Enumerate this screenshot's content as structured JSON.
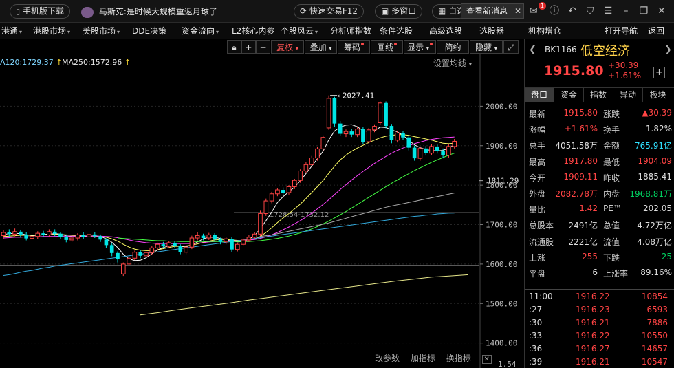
{
  "topbar": {
    "mobile_download": "手机版下载",
    "news_source": "马斯克:",
    "news_text": "是时候大规模重返月球了",
    "quick_trade": "快速交易F12",
    "multi_window": "多窗口",
    "self_select": "自选",
    "view_news": "查看新消息",
    "badge_count": "1"
  },
  "menubar": {
    "items": [
      "港通",
      "港股市场",
      "美股市场",
      "DDE决策",
      "资金流向",
      "L2核心内参",
      "个股风云",
      "分析师指数",
      "条件选股",
      "高级选股",
      "选股器",
      "机构增仓",
      "打开导航",
      "返回"
    ]
  },
  "chart_toolbar": {
    "fuquan": "复权",
    "overlay": "叠加",
    "chips": "筹码",
    "draw": "画线",
    "display": "显示",
    "simple": "简约",
    "hide": "隐藏"
  },
  "ma_labels": {
    "ma120": "A120:1729.37",
    "ma250": "MA250:1572.96"
  },
  "setting_ma": "设置均线",
  "annotations": {
    "high": "2027.41",
    "range": "1728.54-1732.12"
  },
  "bottom_links": [
    "改参数",
    "加指标",
    "换指标"
  ],
  "chart_data": {
    "type": "candlestick",
    "y_ticks": [
      2000,
      1900,
      1800,
      1700,
      1600,
      1500,
      1400
    ],
    "y_tick_labels": [
      "2000.00",
      "1900.00",
      "1800.00",
      "1700.00",
      "1600.00",
      "1500.00",
      "1400.00"
    ],
    "current_price_label": "1811.29",
    "ylim": [
      1375,
      2100
    ],
    "high_marker": 2027.41,
    "range_marker_level": 1730.3,
    "bottom_tick_label": "1.54",
    "candles": [
      {
        "o": 1672,
        "c": 1680,
        "h": 1686,
        "l": 1664
      },
      {
        "o": 1680,
        "c": 1676,
        "h": 1688,
        "l": 1668
      },
      {
        "o": 1676,
        "c": 1682,
        "h": 1690,
        "l": 1670
      },
      {
        "o": 1682,
        "c": 1675,
        "h": 1687,
        "l": 1667
      },
      {
        "o": 1675,
        "c": 1665,
        "h": 1680,
        "l": 1660
      },
      {
        "o": 1665,
        "c": 1670,
        "h": 1676,
        "l": 1658
      },
      {
        "o": 1670,
        "c": 1678,
        "h": 1683,
        "l": 1664
      },
      {
        "o": 1678,
        "c": 1674,
        "h": 1684,
        "l": 1668
      },
      {
        "o": 1674,
        "c": 1682,
        "h": 1688,
        "l": 1670
      },
      {
        "o": 1682,
        "c": 1677,
        "h": 1688,
        "l": 1671
      },
      {
        "o": 1677,
        "c": 1669,
        "h": 1681,
        "l": 1663
      },
      {
        "o": 1669,
        "c": 1661,
        "h": 1674,
        "l": 1655
      },
      {
        "o": 1661,
        "c": 1666,
        "h": 1671,
        "l": 1656
      },
      {
        "o": 1666,
        "c": 1674,
        "h": 1678,
        "l": 1660
      },
      {
        "o": 1674,
        "c": 1669,
        "h": 1680,
        "l": 1663
      },
      {
        "o": 1669,
        "c": 1675,
        "h": 1681,
        "l": 1664
      },
      {
        "o": 1675,
        "c": 1671,
        "h": 1680,
        "l": 1666
      },
      {
        "o": 1671,
        "c": 1662,
        "h": 1675,
        "l": 1656
      },
      {
        "o": 1662,
        "c": 1648,
        "h": 1665,
        "l": 1640
      },
      {
        "o": 1648,
        "c": 1628,
        "h": 1652,
        "l": 1620
      },
      {
        "o": 1628,
        "c": 1612,
        "h": 1632,
        "l": 1604
      },
      {
        "o": 1575,
        "c": 1600,
        "h": 1604,
        "l": 1570
      },
      {
        "o": 1600,
        "c": 1615,
        "h": 1620,
        "l": 1596
      },
      {
        "o": 1615,
        "c": 1630,
        "h": 1634,
        "l": 1610
      },
      {
        "o": 1630,
        "c": 1621,
        "h": 1635,
        "l": 1615
      },
      {
        "o": 1621,
        "c": 1629,
        "h": 1634,
        "l": 1616
      },
      {
        "o": 1629,
        "c": 1641,
        "h": 1646,
        "l": 1624
      },
      {
        "o": 1641,
        "c": 1650,
        "h": 1654,
        "l": 1636
      },
      {
        "o": 1650,
        "c": 1645,
        "h": 1656,
        "l": 1640
      },
      {
        "o": 1645,
        "c": 1654,
        "h": 1659,
        "l": 1640
      },
      {
        "o": 1654,
        "c": 1646,
        "h": 1658,
        "l": 1640
      },
      {
        "o": 1646,
        "c": 1630,
        "h": 1650,
        "l": 1625
      },
      {
        "o": 1630,
        "c": 1643,
        "h": 1648,
        "l": 1625
      },
      {
        "o": 1643,
        "c": 1666,
        "h": 1672,
        "l": 1638
      },
      {
        "o": 1666,
        "c": 1672,
        "h": 1680,
        "l": 1660
      },
      {
        "o": 1672,
        "c": 1666,
        "h": 1677,
        "l": 1660
      },
      {
        "o": 1666,
        "c": 1674,
        "h": 1679,
        "l": 1661
      },
      {
        "o": 1674,
        "c": 1662,
        "h": 1678,
        "l": 1657
      },
      {
        "o": 1662,
        "c": 1656,
        "h": 1667,
        "l": 1650
      },
      {
        "o": 1656,
        "c": 1664,
        "h": 1668,
        "l": 1650
      },
      {
        "o": 1664,
        "c": 1637,
        "h": 1668,
        "l": 1630
      },
      {
        "o": 1637,
        "c": 1650,
        "h": 1654,
        "l": 1632
      },
      {
        "o": 1650,
        "c": 1661,
        "h": 1665,
        "l": 1645
      },
      {
        "o": 1661,
        "c": 1668,
        "h": 1673,
        "l": 1656
      },
      {
        "o": 1668,
        "c": 1676,
        "h": 1681,
        "l": 1663
      },
      {
        "o": 1676,
        "c": 1728,
        "h": 1735,
        "l": 1671
      },
      {
        "o": 1728,
        "c": 1760,
        "h": 1766,
        "l": 1722
      },
      {
        "o": 1760,
        "c": 1778,
        "h": 1783,
        "l": 1754
      },
      {
        "o": 1778,
        "c": 1788,
        "h": 1793,
        "l": 1772
      },
      {
        "o": 1788,
        "c": 1781,
        "h": 1794,
        "l": 1776
      },
      {
        "o": 1781,
        "c": 1796,
        "h": 1800,
        "l": 1776
      },
      {
        "o": 1796,
        "c": 1812,
        "h": 1816,
        "l": 1790
      },
      {
        "o": 1812,
        "c": 1836,
        "h": 1840,
        "l": 1806
      },
      {
        "o": 1836,
        "c": 1852,
        "h": 1858,
        "l": 1830
      },
      {
        "o": 1852,
        "c": 1869,
        "h": 1874,
        "l": 1846
      },
      {
        "o": 1869,
        "c": 1892,
        "h": 1896,
        "l": 1862
      },
      {
        "o": 1892,
        "c": 1921,
        "h": 1926,
        "l": 1886
      },
      {
        "o": 1945,
        "c": 2020,
        "h": 2027.41,
        "l": 1940
      },
      {
        "o": 2020,
        "c": 1956,
        "h": 2024,
        "l": 1948
      },
      {
        "o": 1956,
        "c": 1930,
        "h": 1962,
        "l": 1924
      },
      {
        "o": 1930,
        "c": 1936,
        "h": 1941,
        "l": 1922
      },
      {
        "o": 1936,
        "c": 1928,
        "h": 1942,
        "l": 1922
      },
      {
        "o": 1928,
        "c": 1942,
        "h": 1948,
        "l": 1922
      },
      {
        "o": 1942,
        "c": 1910,
        "h": 1948,
        "l": 1904
      },
      {
        "o": 1910,
        "c": 1940,
        "h": 1945,
        "l": 1905
      },
      {
        "o": 1940,
        "c": 1949,
        "h": 1954,
        "l": 1934
      },
      {
        "o": 1958,
        "c": 2008,
        "h": 2012,
        "l": 1952
      },
      {
        "o": 2008,
        "c": 1950,
        "h": 2012,
        "l": 1944
      },
      {
        "o": 1950,
        "c": 1914,
        "h": 1955,
        "l": 1906
      },
      {
        "o": 1914,
        "c": 1932,
        "h": 1938,
        "l": 1908
      },
      {
        "o": 1932,
        "c": 1921,
        "h": 1938,
        "l": 1914
      },
      {
        "o": 1921,
        "c": 1895,
        "h": 1926,
        "l": 1888
      },
      {
        "o": 1895,
        "c": 1868,
        "h": 1900,
        "l": 1862
      },
      {
        "o": 1868,
        "c": 1893,
        "h": 1898,
        "l": 1862
      },
      {
        "o": 1893,
        "c": 1881,
        "h": 1899,
        "l": 1875
      },
      {
        "o": 1881,
        "c": 1898,
        "h": 1903,
        "l": 1876
      },
      {
        "o": 1898,
        "c": 1886,
        "h": 1904,
        "l": 1880
      },
      {
        "o": 1886,
        "c": 1876,
        "h": 1893,
        "l": 1868
      },
      {
        "o": 1876,
        "c": 1898,
        "h": 1904,
        "l": 1870
      },
      {
        "o": 1898,
        "c": 1911,
        "h": 1917,
        "l": 1893
      }
    ],
    "ma_lines": [
      {
        "color": "#ffffff",
        "values": [
          1675,
          1677,
          1678,
          1677,
          1674,
          1672,
          1673,
          1675,
          1676,
          1677,
          1676,
          1672,
          1669,
          1669,
          1670,
          1671,
          1672,
          1670,
          1664,
          1655,
          1642,
          1625,
          1613,
          1609,
          1610,
          1616,
          1626,
          1636,
          1642,
          1646,
          1648,
          1644,
          1644,
          1648,
          1656,
          1664,
          1668,
          1668,
          1665,
          1662,
          1658,
          1656,
          1657,
          1663,
          1672,
          1690,
          1710,
          1732,
          1756,
          1771,
          1783,
          1795,
          1811,
          1829,
          1848,
          1867,
          1886,
          1915,
          1937,
          1947,
          1952,
          1953,
          1948,
          1938,
          1936,
          1938,
          1947,
          1946,
          1940,
          1935,
          1926,
          1914,
          1902,
          1895,
          1890,
          1888,
          1887,
          1888,
          1894,
          1902
        ]
      },
      {
        "color": "#ffff66",
        "values": [
          1670,
          1671,
          1672,
          1673,
          1673,
          1673,
          1673,
          1674,
          1674,
          1675,
          1675,
          1674,
          1673,
          1672,
          1672,
          1671,
          1671,
          1670,
          1668,
          1664,
          1658,
          1650,
          1643,
          1638,
          1635,
          1634,
          1634,
          1636,
          1639,
          1642,
          1645,
          1645,
          1646,
          1648,
          1651,
          1655,
          1658,
          1661,
          1662,
          1662,
          1661,
          1660,
          1660,
          1661,
          1663,
          1670,
          1680,
          1692,
          1705,
          1717,
          1728,
          1740,
          1752,
          1766,
          1781,
          1796,
          1812,
          1830,
          1848,
          1864,
          1876,
          1886,
          1894,
          1901,
          1908,
          1914,
          1920,
          1924,
          1926,
          1928,
          1928,
          1926,
          1923,
          1920,
          1917,
          1914,
          1910,
          1906,
          1905,
          1906
        ]
      },
      {
        "color": "#ff44ff",
        "values": [
          1666,
          1667,
          1668,
          1668,
          1669,
          1669,
          1669,
          1670,
          1670,
          1670,
          1671,
          1671,
          1671,
          1671,
          1671,
          1671,
          1671,
          1671,
          1670,
          1669,
          1667,
          1664,
          1661,
          1658,
          1656,
          1654,
          1653,
          1652,
          1652,
          1652,
          1652,
          1652,
          1652,
          1652,
          1653,
          1654,
          1656,
          1657,
          1658,
          1659,
          1659,
          1659,
          1660,
          1661,
          1662,
          1665,
          1669,
          1674,
          1680,
          1687,
          1694,
          1702,
          1710,
          1719,
          1729,
          1740,
          1751,
          1763,
          1776,
          1789,
          1801,
          1813,
          1824,
          1835,
          1845,
          1855,
          1864,
          1873,
          1881,
          1888,
          1894,
          1900,
          1905,
          1909,
          1913,
          1916,
          1918,
          1920,
          1921,
          1922
        ]
      },
      {
        "color": "#44ff44",
        "values": [
          null,
          null,
          null,
          null,
          null,
          null,
          null,
          null,
          null,
          null,
          null,
          null,
          null,
          null,
          null,
          null,
          null,
          null,
          null,
          null,
          1666,
          1665,
          1664,
          1663,
          1662,
          1661,
          1660,
          1659,
          1659,
          1658,
          1658,
          1657,
          1657,
          1657,
          1657,
          1657,
          1657,
          1657,
          1657,
          1657,
          1657,
          1657,
          1657,
          1657,
          1658,
          1659,
          1661,
          1663,
          1665,
          1668,
          1671,
          1675,
          1679,
          1684,
          1689,
          1695,
          1702,
          1709,
          1717,
          1725,
          1733,
          1742,
          1751,
          1760,
          1769,
          1778,
          1787,
          1796,
          1805,
          1813,
          1821,
          1829,
          1837,
          1844,
          1851,
          1858,
          1864,
          1870,
          1876,
          1881
        ]
      },
      {
        "color": "#aaaaaa",
        "values": [
          null,
          null,
          null,
          null,
          null,
          null,
          null,
          null,
          null,
          null,
          null,
          null,
          null,
          null,
          null,
          null,
          null,
          null,
          null,
          null,
          null,
          null,
          null,
          null,
          null,
          null,
          null,
          null,
          null,
          null,
          null,
          null,
          null,
          null,
          null,
          null,
          null,
          null,
          null,
          null,
          null,
          null,
          null,
          null,
          null,
          1670,
          1672,
          1674,
          1677,
          1680,
          1683,
          1686,
          1689,
          1692,
          1695,
          1698,
          1701,
          1704,
          1708,
          1712,
          1716,
          1720,
          1724,
          1728,
          1732,
          1736,
          1740,
          1744,
          1747,
          1750,
          1753,
          1756,
          1759,
          1762,
          1765,
          1768,
          1771,
          1774,
          1777,
          1780
        ]
      },
      {
        "color": "#33aadd",
        "values": [
          1571,
          1573,
          1576,
          1579,
          1582,
          1584,
          1587,
          1590,
          1592,
          1595,
          1597,
          1599,
          1601,
          1603,
          1605,
          1607,
          1609,
          1611,
          1613,
          1615,
          1617,
          1619,
          1621,
          1623,
          1625,
          1627,
          1629,
          1631,
          1633,
          1635,
          1637,
          1639,
          1641,
          1643,
          1645,
          1647,
          1649,
          1651,
          1653,
          1655,
          1657,
          1659,
          1661,
          1663,
          1665,
          1667,
          1669,
          1671,
          1673,
          1675,
          1677,
          1679,
          1681,
          1683,
          1685,
          1687,
          1689,
          1691,
          1693,
          1695,
          1697,
          1699,
          1701,
          1703,
          1705,
          1707,
          1709,
          1711,
          1713,
          1715,
          1717,
          1719,
          1721,
          1722,
          1724,
          1725,
          1727,
          1728,
          1729,
          1729.37
        ]
      }
    ],
    "ma250_line": {
      "color": "#e6e68a",
      "values": [
        1471,
        1477,
        1484,
        1490,
        1496,
        1502,
        1509,
        1515,
        1521,
        1527,
        1533,
        1539,
        1545,
        1551,
        1557,
        1562,
        1567,
        1570,
        1572.96
      ]
    }
  },
  "quote": {
    "code": "BK1166",
    "name": "低空经济",
    "price": "1915.80",
    "change": "+30.39",
    "change_pct": "+1.61%"
  },
  "tabs": [
    "盘口",
    "资金",
    "指数",
    "异动",
    "板块"
  ],
  "stats": [
    {
      "l1": "最新",
      "v1": "1915.80",
      "c1": "red",
      "l2": "涨跌",
      "v2": "▲30.39",
      "c2": "red"
    },
    {
      "l1": "涨幅",
      "v1": "+1.61%",
      "c1": "red",
      "l2": "换手",
      "v2": "1.82%",
      "c2": "wht"
    },
    {
      "l1": "总手",
      "v1": "4051.58万",
      "c1": "wht",
      "l2": "金额",
      "v2": "765.91亿",
      "c2": "cyan"
    },
    {
      "l1": "最高",
      "v1": "1917.80",
      "c1": "red",
      "l2": "最低",
      "v2": "1904.09",
      "c2": "red"
    },
    {
      "l1": "今开",
      "v1": "1909.11",
      "c1": "red",
      "l2": "昨收",
      "v2": "1885.41",
      "c2": "wht"
    },
    {
      "l1": "外盘",
      "v1": "2082.78万",
      "c1": "red",
      "l2": "内盘",
      "v2": "1968.81万",
      "c2": "grn"
    },
    {
      "l1": "量比",
      "v1": "1.42",
      "c1": "red",
      "l2": "PE™",
      "v2": "202.05",
      "c2": "wht"
    },
    {
      "l1": "总股本",
      "v1": "2491亿",
      "c1": "wht",
      "l2": "总值",
      "v2": "4.72万亿",
      "c2": "wht"
    },
    {
      "l1": "流通股",
      "v1": "2221亿",
      "c1": "wht",
      "l2": "流值",
      "v2": "4.08万亿",
      "c2": "wht"
    },
    {
      "l1": "上涨",
      "v1": "255",
      "c1": "red",
      "l2": "下跌",
      "v2": "25",
      "c2": "grn"
    },
    {
      "l1": "平盘",
      "v1": "6",
      "c1": "wht",
      "l2": "上涨率",
      "v2": "89.16%",
      "c2": "wht"
    }
  ],
  "ticks": [
    {
      "time": "11:00",
      "price": "1916.22",
      "vol": "10854"
    },
    {
      "time": ":27",
      "price": "1916.23",
      "vol": "6593"
    },
    {
      "time": ":30",
      "price": "1916.21",
      "vol": "7886"
    },
    {
      "time": ":33",
      "price": "1916.22",
      "vol": "10550"
    },
    {
      "time": ":36",
      "price": "1916.27",
      "vol": "14657"
    },
    {
      "time": ":39",
      "price": "1916.21",
      "vol": "10547"
    }
  ],
  "colors": {
    "up": "#ff4444",
    "down": "#00e5e5",
    "grid": "#262626"
  }
}
